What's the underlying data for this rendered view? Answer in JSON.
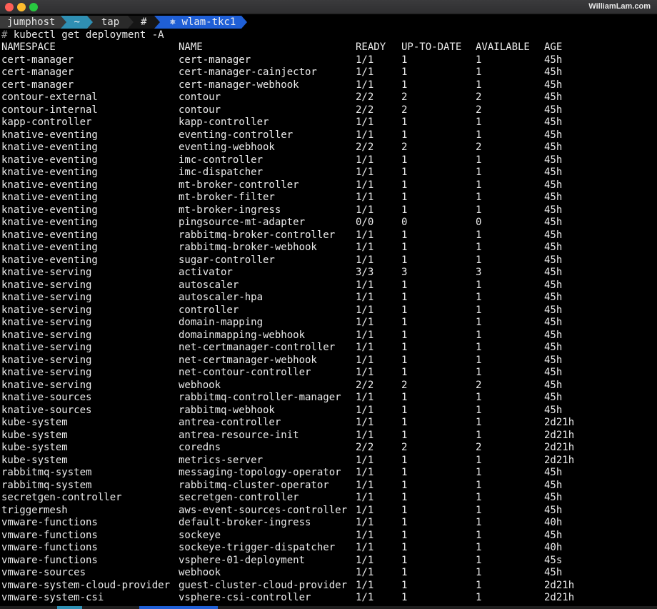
{
  "window": {
    "watermark": "WilliamLam.com"
  },
  "prompt": {
    "host": "jumphost",
    "dir": "~",
    "repo": "tap",
    "hash": "#",
    "context": "⎈ wlam-tkc1"
  },
  "command": {
    "hash": "#",
    "text": "kubectl get deployment -A"
  },
  "table": {
    "headers": [
      "NAMESPACE",
      "NAME",
      "READY",
      "UP-TO-DATE",
      "AVAILABLE",
      "AGE"
    ],
    "rows": [
      [
        "cert-manager",
        "cert-manager",
        "1/1",
        "1",
        "1",
        "45h"
      ],
      [
        "cert-manager",
        "cert-manager-cainjector",
        "1/1",
        "1",
        "1",
        "45h"
      ],
      [
        "cert-manager",
        "cert-manager-webhook",
        "1/1",
        "1",
        "1",
        "45h"
      ],
      [
        "contour-external",
        "contour",
        "2/2",
        "2",
        "2",
        "45h"
      ],
      [
        "contour-internal",
        "contour",
        "2/2",
        "2",
        "2",
        "45h"
      ],
      [
        "kapp-controller",
        "kapp-controller",
        "1/1",
        "1",
        "1",
        "45h"
      ],
      [
        "knative-eventing",
        "eventing-controller",
        "1/1",
        "1",
        "1",
        "45h"
      ],
      [
        "knative-eventing",
        "eventing-webhook",
        "2/2",
        "2",
        "2",
        "45h"
      ],
      [
        "knative-eventing",
        "imc-controller",
        "1/1",
        "1",
        "1",
        "45h"
      ],
      [
        "knative-eventing",
        "imc-dispatcher",
        "1/1",
        "1",
        "1",
        "45h"
      ],
      [
        "knative-eventing",
        "mt-broker-controller",
        "1/1",
        "1",
        "1",
        "45h"
      ],
      [
        "knative-eventing",
        "mt-broker-filter",
        "1/1",
        "1",
        "1",
        "45h"
      ],
      [
        "knative-eventing",
        "mt-broker-ingress",
        "1/1",
        "1",
        "1",
        "45h"
      ],
      [
        "knative-eventing",
        "pingsource-mt-adapter",
        "0/0",
        "0",
        "0",
        "45h"
      ],
      [
        "knative-eventing",
        "rabbitmq-broker-controller",
        "1/1",
        "1",
        "1",
        "45h"
      ],
      [
        "knative-eventing",
        "rabbitmq-broker-webhook",
        "1/1",
        "1",
        "1",
        "45h"
      ],
      [
        "knative-eventing",
        "sugar-controller",
        "1/1",
        "1",
        "1",
        "45h"
      ],
      [
        "knative-serving",
        "activator",
        "3/3",
        "3",
        "3",
        "45h"
      ],
      [
        "knative-serving",
        "autoscaler",
        "1/1",
        "1",
        "1",
        "45h"
      ],
      [
        "knative-serving",
        "autoscaler-hpa",
        "1/1",
        "1",
        "1",
        "45h"
      ],
      [
        "knative-serving",
        "controller",
        "1/1",
        "1",
        "1",
        "45h"
      ],
      [
        "knative-serving",
        "domain-mapping",
        "1/1",
        "1",
        "1",
        "45h"
      ],
      [
        "knative-serving",
        "domainmapping-webhook",
        "1/1",
        "1",
        "1",
        "45h"
      ],
      [
        "knative-serving",
        "net-certmanager-controller",
        "1/1",
        "1",
        "1",
        "45h"
      ],
      [
        "knative-serving",
        "net-certmanager-webhook",
        "1/1",
        "1",
        "1",
        "45h"
      ],
      [
        "knative-serving",
        "net-contour-controller",
        "1/1",
        "1",
        "1",
        "45h"
      ],
      [
        "knative-serving",
        "webhook",
        "2/2",
        "2",
        "2",
        "45h"
      ],
      [
        "knative-sources",
        "rabbitmq-controller-manager",
        "1/1",
        "1",
        "1",
        "45h"
      ],
      [
        "knative-sources",
        "rabbitmq-webhook",
        "1/1",
        "1",
        "1",
        "45h"
      ],
      [
        "kube-system",
        "antrea-controller",
        "1/1",
        "1",
        "1",
        "2d21h"
      ],
      [
        "kube-system",
        "antrea-resource-init",
        "1/1",
        "1",
        "1",
        "2d21h"
      ],
      [
        "kube-system",
        "coredns",
        "2/2",
        "2",
        "2",
        "2d21h"
      ],
      [
        "kube-system",
        "metrics-server",
        "1/1",
        "1",
        "1",
        "2d21h"
      ],
      [
        "rabbitmq-system",
        "messaging-topology-operator",
        "1/1",
        "1",
        "1",
        "45h"
      ],
      [
        "rabbitmq-system",
        "rabbitmq-cluster-operator",
        "1/1",
        "1",
        "1",
        "45h"
      ],
      [
        "secretgen-controller",
        "secretgen-controller",
        "1/1",
        "1",
        "1",
        "45h"
      ],
      [
        "triggermesh",
        "aws-event-sources-controller",
        "1/1",
        "1",
        "1",
        "45h"
      ],
      [
        "vmware-functions",
        "default-broker-ingress",
        "1/1",
        "1",
        "1",
        "40h"
      ],
      [
        "vmware-functions",
        "sockeye",
        "1/1",
        "1",
        "1",
        "45h"
      ],
      [
        "vmware-functions",
        "sockeye-trigger-dispatcher",
        "1/1",
        "1",
        "1",
        "40h"
      ],
      [
        "vmware-functions",
        "vsphere-01-deployment",
        "1/1",
        "1",
        "1",
        "45s"
      ],
      [
        "vmware-sources",
        "webhook",
        "1/1",
        "1",
        "1",
        "45h"
      ],
      [
        "vmware-system-cloud-provider",
        "guest-cluster-cloud-provider",
        "1/1",
        "1",
        "1",
        "2d21h"
      ],
      [
        "vmware-system-csi",
        "vsphere-csi-controller",
        "1/1",
        "1",
        "1",
        "2d21h"
      ]
    ]
  }
}
